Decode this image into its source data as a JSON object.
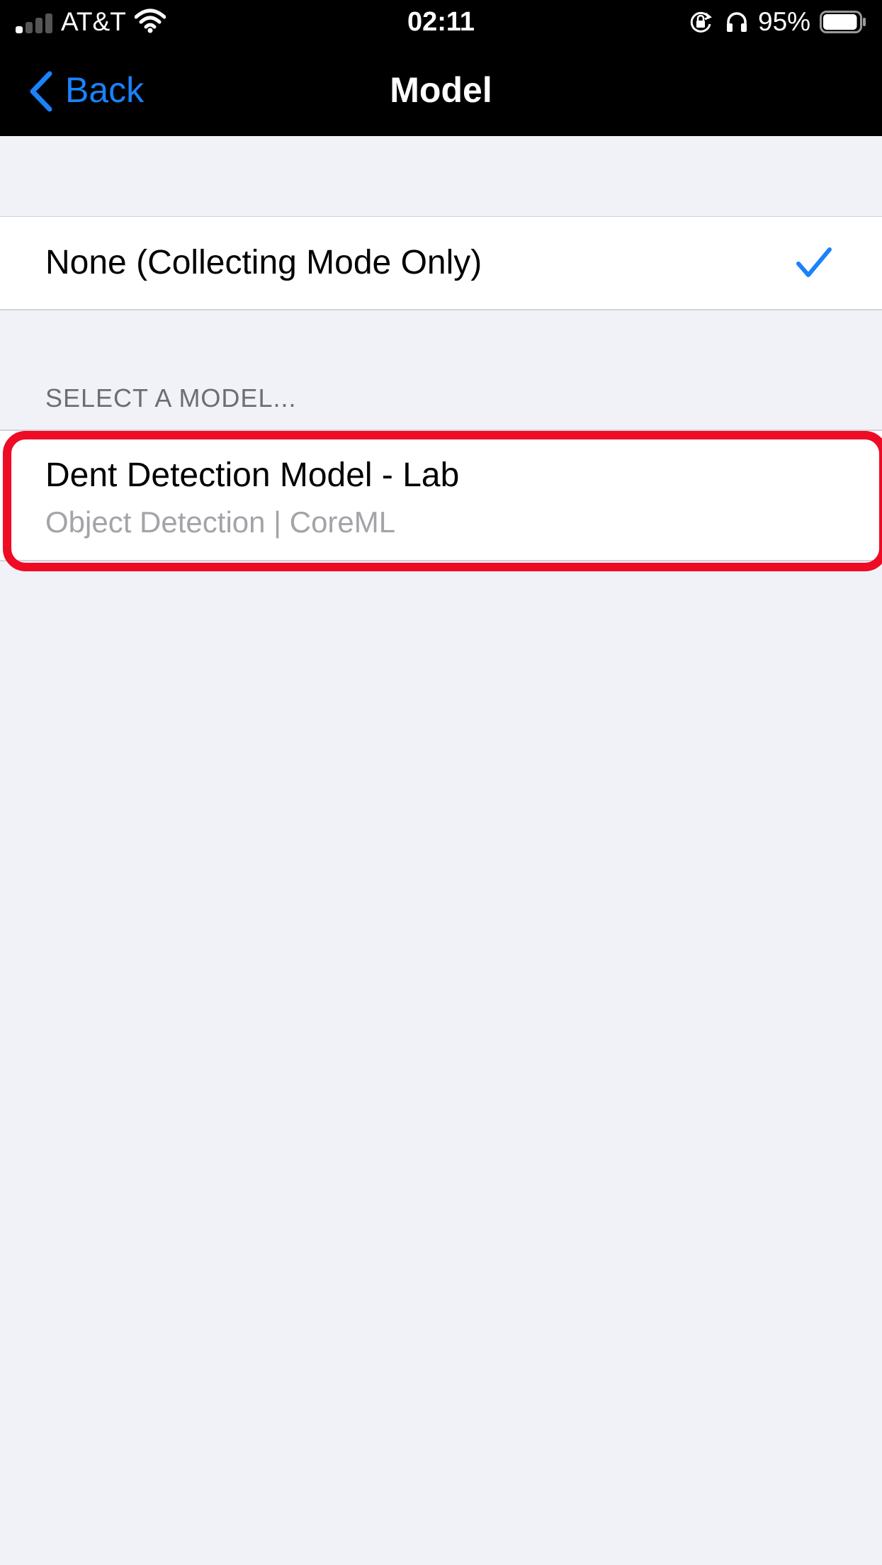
{
  "status_bar": {
    "carrier": "AT&T",
    "time": "02:11",
    "battery_percent": "95%",
    "battery_level": 0.95,
    "signal_bars_filled": 1,
    "signal_bars_total": 4,
    "icons": [
      "signal-icon",
      "wifi-icon",
      "rotation-lock-icon",
      "headphones-icon",
      "battery-icon"
    ]
  },
  "nav": {
    "back_label": "Back",
    "title": "Model"
  },
  "options": {
    "none_label": "None (Collecting Mode Only)",
    "none_selected": true
  },
  "section": {
    "header": "SELECT A MODEL..."
  },
  "models": [
    {
      "title": "Dent Detection Model - Lab",
      "subtitle": "Object Detection | CoreML"
    }
  ],
  "colors": {
    "accent": "#1a82fb",
    "highlight": "#ee0b24",
    "background": "#f1f2f7",
    "bar_background": "#000000",
    "secondary_text": "#a3a3a8",
    "section_header_text": "#6d6d72"
  }
}
